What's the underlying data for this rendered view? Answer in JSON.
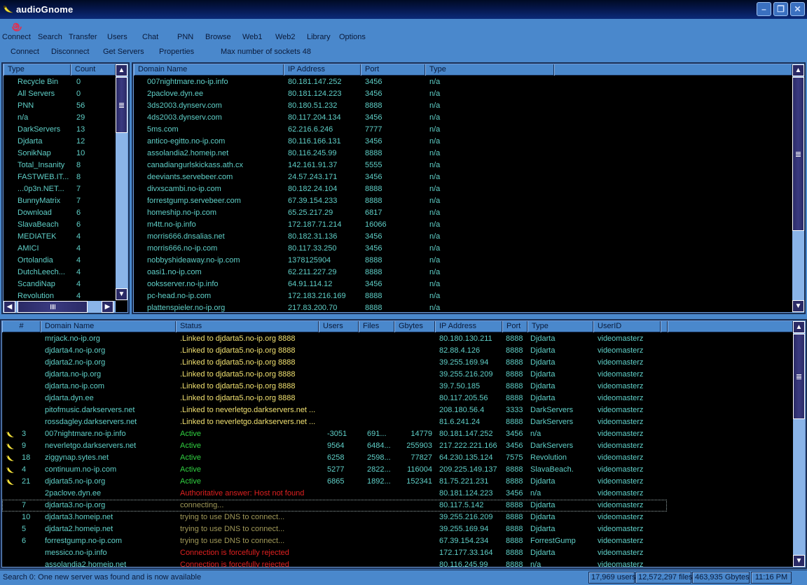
{
  "window": {
    "title": "audioGnome",
    "buttons": {
      "minimize": "–",
      "restore": "❐",
      "close": "✕"
    }
  },
  "menu": {
    "items": [
      {
        "label": "Connect"
      },
      {
        "label": "Search"
      },
      {
        "label": "Transfer"
      },
      {
        "label": "Users"
      },
      {
        "label": "Chat"
      },
      {
        "label": "PNN"
      },
      {
        "label": "Browse"
      },
      {
        "label": "Web1"
      },
      {
        "label": "Web2"
      },
      {
        "label": "Library"
      },
      {
        "label": "Options"
      }
    ]
  },
  "toolbar": {
    "connect": "Connect",
    "disconnect": "Disconnect",
    "get_servers": "Get Servers",
    "properties": "Properties",
    "max_sockets": "Max number of sockets 48"
  },
  "type_list": {
    "headers": [
      "Type",
      "Count"
    ],
    "rows": [
      [
        "Recycle Bin",
        "0"
      ],
      [
        "All Servers",
        "0"
      ],
      [
        "PNN",
        "56"
      ],
      [
        "n/a",
        "29"
      ],
      [
        "DarkServers",
        "13"
      ],
      [
        "Djdarta",
        "12"
      ],
      [
        "SonikNap",
        "10"
      ],
      [
        "Total_Insanity",
        "8"
      ],
      [
        "FASTWEB.IT...",
        "8"
      ],
      [
        "...0p3n.NET...",
        "7"
      ],
      [
        "BunnyMatrix",
        "7"
      ],
      [
        "Download",
        "6"
      ],
      [
        "SlavaBeach",
        "6"
      ],
      [
        "MEDIATEK",
        "4"
      ],
      [
        "AMICI",
        "4"
      ],
      [
        "Ortolandia",
        "4"
      ],
      [
        "DutchLeech...",
        "4"
      ],
      [
        "ScandiNap",
        "4"
      ],
      [
        "Revolution",
        "4"
      ]
    ]
  },
  "server_list": {
    "headers": [
      "Domain Name",
      "IP Address",
      "Port",
      "Type",
      ""
    ],
    "rows": [
      [
        "007nightmare.no-ip.info",
        "80.181.147.252",
        "3456",
        "n/a"
      ],
      [
        "2paclove.dyn.ee",
        "80.181.124.223",
        "3456",
        "n/a"
      ],
      [
        "3ds2003.dynserv.com",
        "80.180.51.232",
        "8888",
        "n/a"
      ],
      [
        "4ds2003.dynserv.com",
        "80.117.204.134",
        "3456",
        "n/a"
      ],
      [
        "5ms.com",
        "62.216.6.246",
        "7777",
        "n/a"
      ],
      [
        "antico-egitto.no-ip.com",
        "80.116.166.131",
        "3456",
        "n/a"
      ],
      [
        "assolandia2.homeip.net",
        "80.116.245.99",
        "8888",
        "n/a"
      ],
      [
        "canadiangurlskickass.ath.cx",
        "142.161.91.37",
        "5555",
        "n/a"
      ],
      [
        "deeviants.servebeer.com",
        "24.57.243.171",
        "3456",
        "n/a"
      ],
      [
        "divxscambi.no-ip.com",
        "80.182.24.104",
        "8888",
        "n/a"
      ],
      [
        "forrestgump.servebeer.com",
        "67.39.154.233",
        "8888",
        "n/a"
      ],
      [
        "homeship.no-ip.com",
        "65.25.217.29",
        "6817",
        "n/a"
      ],
      [
        "m4tt.no-ip.info",
        "172.187.71.214",
        "16066",
        "n/a"
      ],
      [
        "morris666.dnsalias.net",
        "80.182.31.136",
        "3456",
        "n/a"
      ],
      [
        "morris666.no-ip.com",
        "80.117.33.250",
        "3456",
        "n/a"
      ],
      [
        "nobbyshideaway.no-ip.com",
        "1378125904",
        "8888",
        "n/a"
      ],
      [
        "oasi1.no-ip.com",
        "62.211.227.29",
        "8888",
        "n/a"
      ],
      [
        "ooksserver.no-ip.info",
        "64.91.114.12",
        "3456",
        "n/a"
      ],
      [
        "pc-head.no-ip.com",
        "172.183.216.169",
        "8888",
        "n/a"
      ],
      [
        "plattenspieler.no-ip.org",
        "217.83.200.70",
        "8888",
        "n/a"
      ]
    ]
  },
  "connections": {
    "headers": [
      "#",
      "Domain Name",
      "Status",
      "Users",
      "Files",
      "Gbytes",
      "IP Address",
      "Port",
      "Type",
      "UserID",
      "",
      ""
    ],
    "rows": [
      {
        "icon": false,
        "num": "",
        "domain": "mrjack.no-ip.org",
        "status": ".Linked to djdarta5.no-ip.org 8888",
        "status_kind": "linked",
        "users": "",
        "files": "",
        "gbytes": "",
        "ip": "80.180.130.211",
        "port": "8888",
        "type": "Djdarta",
        "userid": "videomasterz"
      },
      {
        "icon": false,
        "num": "",
        "domain": "djdarta4.no-ip.org",
        "status": ".Linked to djdarta5.no-ip.org 8888",
        "status_kind": "linked",
        "users": "",
        "files": "",
        "gbytes": "",
        "ip": "82.88.4.126",
        "port": "8888",
        "type": "Djdarta",
        "userid": "videomasterz"
      },
      {
        "icon": false,
        "num": "",
        "domain": "djdarta2.no-ip.org",
        "status": ".Linked to djdarta5.no-ip.org 8888",
        "status_kind": "linked",
        "users": "",
        "files": "",
        "gbytes": "",
        "ip": "39.255.169.94",
        "port": "8888",
        "type": "Djdarta",
        "userid": "videomasterz"
      },
      {
        "icon": false,
        "num": "",
        "domain": "djdarta.no-ip.org",
        "status": ".Linked to djdarta5.no-ip.org 8888",
        "status_kind": "linked",
        "users": "",
        "files": "",
        "gbytes": "",
        "ip": "39.255.216.209",
        "port": "8888",
        "type": "Djdarta",
        "userid": "videomasterz"
      },
      {
        "icon": false,
        "num": "",
        "domain": "djdarta.no-ip.com",
        "status": ".Linked to djdarta5.no-ip.org 8888",
        "status_kind": "linked",
        "users": "",
        "files": "",
        "gbytes": "",
        "ip": "39.7.50.185",
        "port": "8888",
        "type": "Djdarta",
        "userid": "videomasterz"
      },
      {
        "icon": false,
        "num": "",
        "domain": "djdarta.dyn.ee",
        "status": ".Linked to djdarta5.no-ip.org 8888",
        "status_kind": "linked",
        "users": "",
        "files": "",
        "gbytes": "",
        "ip": "80.117.205.56",
        "port": "8888",
        "type": "Djdarta",
        "userid": "videomasterz"
      },
      {
        "icon": false,
        "num": "",
        "domain": "pitofmusic.darkservers.net",
        "status": ".Linked to neverletgo.darkservers.net ...",
        "status_kind": "linked",
        "users": "",
        "files": "",
        "gbytes": "",
        "ip": "208.180.56.4",
        "port": "3333",
        "type": "DarkServers",
        "userid": "videomasterz"
      },
      {
        "icon": false,
        "num": "",
        "domain": "rossdagley.darkservers.net",
        "status": ".Linked to neverletgo.darkservers.net ...",
        "status_kind": "linked",
        "users": "",
        "files": "",
        "gbytes": "",
        "ip": "81.6.241.24",
        "port": "8888",
        "type": "DarkServers",
        "userid": "videomasterz"
      },
      {
        "icon": true,
        "num": "3",
        "domain": "007nightmare.no-ip.info",
        "status": "Active",
        "status_kind": "active",
        "users": "-3051",
        "files": "691...",
        "gbytes": "14779",
        "ip": "80.181.147.252",
        "port": "3456",
        "type": "n/a",
        "userid": "videomasterz"
      },
      {
        "icon": true,
        "num": "9",
        "domain": "neverletgo.darkservers.net",
        "status": "Active",
        "status_kind": "active",
        "users": "9564",
        "files": "6484...",
        "gbytes": "255903",
        "ip": "217.222.221.166",
        "port": "3456",
        "type": "DarkServers",
        "userid": "videomasterz"
      },
      {
        "icon": true,
        "num": "18",
        "domain": "ziggynap.sytes.net",
        "status": "Active",
        "status_kind": "active",
        "users": "6258",
        "files": "2598...",
        "gbytes": "77827",
        "ip": "64.230.135.124",
        "port": "7575",
        "type": "Revolution",
        "userid": "videomasterz"
      },
      {
        "icon": true,
        "num": "4",
        "domain": "continuum.no-ip.com",
        "status": "Active",
        "status_kind": "active",
        "users": "5277",
        "files": "2822...",
        "gbytes": "116004",
        "ip": "209.225.149.137",
        "port": "8888",
        "type": "SlavaBeach.",
        "userid": "videomasterz"
      },
      {
        "icon": true,
        "num": "21",
        "domain": "djdarta5.no-ip.org",
        "status": "Active",
        "status_kind": "active",
        "users": "6865",
        "files": "1892...",
        "gbytes": "152341",
        "ip": "81.75.221.231",
        "port": "8888",
        "type": "Djdarta",
        "userid": "videomasterz"
      },
      {
        "icon": false,
        "num": "",
        "domain": "2paclove.dyn.ee",
        "status": "Authoritative answer: Host not found",
        "status_kind": "error",
        "users": "",
        "files": "",
        "gbytes": "",
        "ip": "80.181.124.223",
        "port": "3456",
        "type": "n/a",
        "userid": "videomasterz"
      },
      {
        "icon": false,
        "num": "7",
        "domain": "djdarta3.no-ip.org",
        "status": "connecting...",
        "status_kind": "pending",
        "users": "",
        "files": "",
        "gbytes": "",
        "ip": "80.117.5.142",
        "port": "8888",
        "type": "Djdarta",
        "userid": "videomasterz",
        "focused": true
      },
      {
        "icon": false,
        "num": "10",
        "domain": "djdarta3.homeip.net",
        "status": "trying to use DNS to connect...",
        "status_kind": "pending",
        "users": "",
        "files": "",
        "gbytes": "",
        "ip": "39.255.216.209",
        "port": "8888",
        "type": "Djdarta",
        "userid": "videomasterz"
      },
      {
        "icon": false,
        "num": "5",
        "domain": "djdarta2.homeip.net",
        "status": "trying to use DNS to connect...",
        "status_kind": "pending",
        "users": "",
        "files": "",
        "gbytes": "",
        "ip": "39.255.169.94",
        "port": "8888",
        "type": "Djdarta",
        "userid": "videomasterz"
      },
      {
        "icon": false,
        "num": "6",
        "domain": "forrestgump.no-ip.com",
        "status": "trying to use DNS to connect...",
        "status_kind": "pending",
        "users": "",
        "files": "",
        "gbytes": "",
        "ip": "67.39.154.234",
        "port": "8888",
        "type": "ForrestGump",
        "userid": "videomasterz"
      },
      {
        "icon": false,
        "num": "",
        "domain": "messico.no-ip.info",
        "status": "Connection is forcefully rejected",
        "status_kind": "error",
        "users": "",
        "files": "",
        "gbytes": "",
        "ip": "172.177.33.164",
        "port": "8888",
        "type": "Djdarta",
        "userid": "videomasterz"
      },
      {
        "icon": false,
        "num": "",
        "domain": "assolandia2.homeip.net",
        "status": "Connection is forcefully rejected",
        "status_kind": "error",
        "users": "",
        "files": "",
        "gbytes": "",
        "ip": "80.116.245.99",
        "port": "8888",
        "type": "n/a",
        "userid": "videomasterz"
      }
    ]
  },
  "status_bar": {
    "message": "Search 0: One new server was found and is now available",
    "users": "17,969 users",
    "files": "12,572,297 files",
    "gbytes": "463,935 Gbytes",
    "time": "11:16 PM"
  },
  "icons": {
    "app": "banana-icon",
    "connect": "spiral-icon",
    "row_active": "banana-icon",
    "scroll_up": "▲",
    "scroll_down": "▼",
    "scroll_left": "◀",
    "scroll_right": "▶"
  },
  "colors": {
    "linked": "#f0e070",
    "active": "#30d040",
    "error": "#e02020",
    "pending": "#a09858",
    "text": "#5fd0c8"
  }
}
